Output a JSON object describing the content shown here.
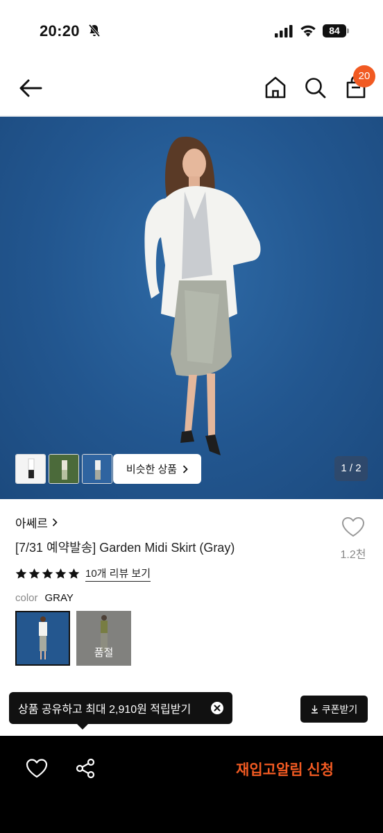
{
  "status_bar": {
    "time": "20:20",
    "battery": "84"
  },
  "header": {
    "cart_count": "20"
  },
  "gallery": {
    "similar_label": "비슷한 상품",
    "page_indicator": "1 / 2"
  },
  "product": {
    "brand": "아쎄르",
    "title": "[7/31 예약발송] Garden Midi Skirt (Gray)",
    "likes": "1.2천",
    "rating": 5,
    "review_link": "10개 리뷰 보기",
    "color_label": "color",
    "color_value": "GRAY",
    "swatch_sold_out": "품절"
  },
  "tooltip": {
    "text": "상품 공유하고 최대 2,910원 적립받기"
  },
  "coupon": {
    "label": "쿠폰받기"
  },
  "bottom_bar": {
    "restock_label": "재입고알림 신청"
  },
  "colors": {
    "accent": "#f15a22",
    "hero_bg": "#22568f",
    "bar_bg": "#000000"
  },
  "icons": [
    "bell-off-icon",
    "signal-icon",
    "wifi-icon",
    "battery-icon",
    "back-arrow-icon",
    "home-icon",
    "search-icon",
    "shopping-bag-icon",
    "chevron-right-icon",
    "heart-icon",
    "star-icon",
    "close-circle-icon",
    "download-icon",
    "share-icon"
  ]
}
